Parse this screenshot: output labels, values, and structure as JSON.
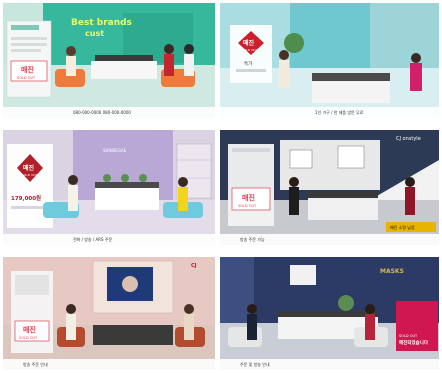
{
  "frames": [
    {
      "id": "frame-1",
      "logo": "SOLD OUT",
      "status_main": "매진",
      "status_sub": "SOLD OUT",
      "wall_text_line1": "Best brands",
      "wall_text_line2": "cust",
      "bottom_bar": "080-000-0000  080-000-0000",
      "accent": "#1fa38d",
      "wall_color": "#35b89b",
      "floor_color": "#cfe9e2"
    },
    {
      "id": "frame-2",
      "status_main": "매진",
      "status_sub": "SOLD OUT",
      "price_label": "특가",
      "bottom_bar": "1인 가구 / 한 제품 방문 무료",
      "accent": "#cc1f2e",
      "wall_color": "#6fc8cf",
      "floor_color": "#d8eef0"
    },
    {
      "id": "frame-3",
      "status_main": "매진",
      "status_sub": "SOLD OUT",
      "price": "179,000원",
      "wall_sign": "SHINSEGAE",
      "bottom_bar": "전화 / 방송 / ARS 주문",
      "accent": "#b0202a",
      "wall_color": "#b9a8d6",
      "floor_color": "#e3dcea"
    },
    {
      "id": "frame-4",
      "channel_logo": "CJ onstyle",
      "status_main": "매진",
      "status_sub": "SOLD OUT",
      "corner_badge": "매진 소량 남음",
      "bottom_bar": "방송 주문 가능",
      "accent": "#e8b400",
      "wall_color": "#2d3a56",
      "floor_color": "#c7c9cf"
    },
    {
      "id": "frame-5",
      "channel_logo": "CJ",
      "status_main": "매진",
      "status_sub": "SOLD OUT",
      "bottom_bar": "방송 주문 안내",
      "accent": "#cc1f2e",
      "wall_color": "#e7c8c2",
      "floor_color": "#dcc7bf"
    },
    {
      "id": "frame-6",
      "wall_sign": "MASKS",
      "status_main": "매진되었습니다",
      "status_sub": "SOLD OUT",
      "bottom_bar": "주문 및 방송 안내",
      "accent": "#d0174f",
      "wall_color": "#2b3b66",
      "floor_color": "#c9ced6"
    }
  ]
}
